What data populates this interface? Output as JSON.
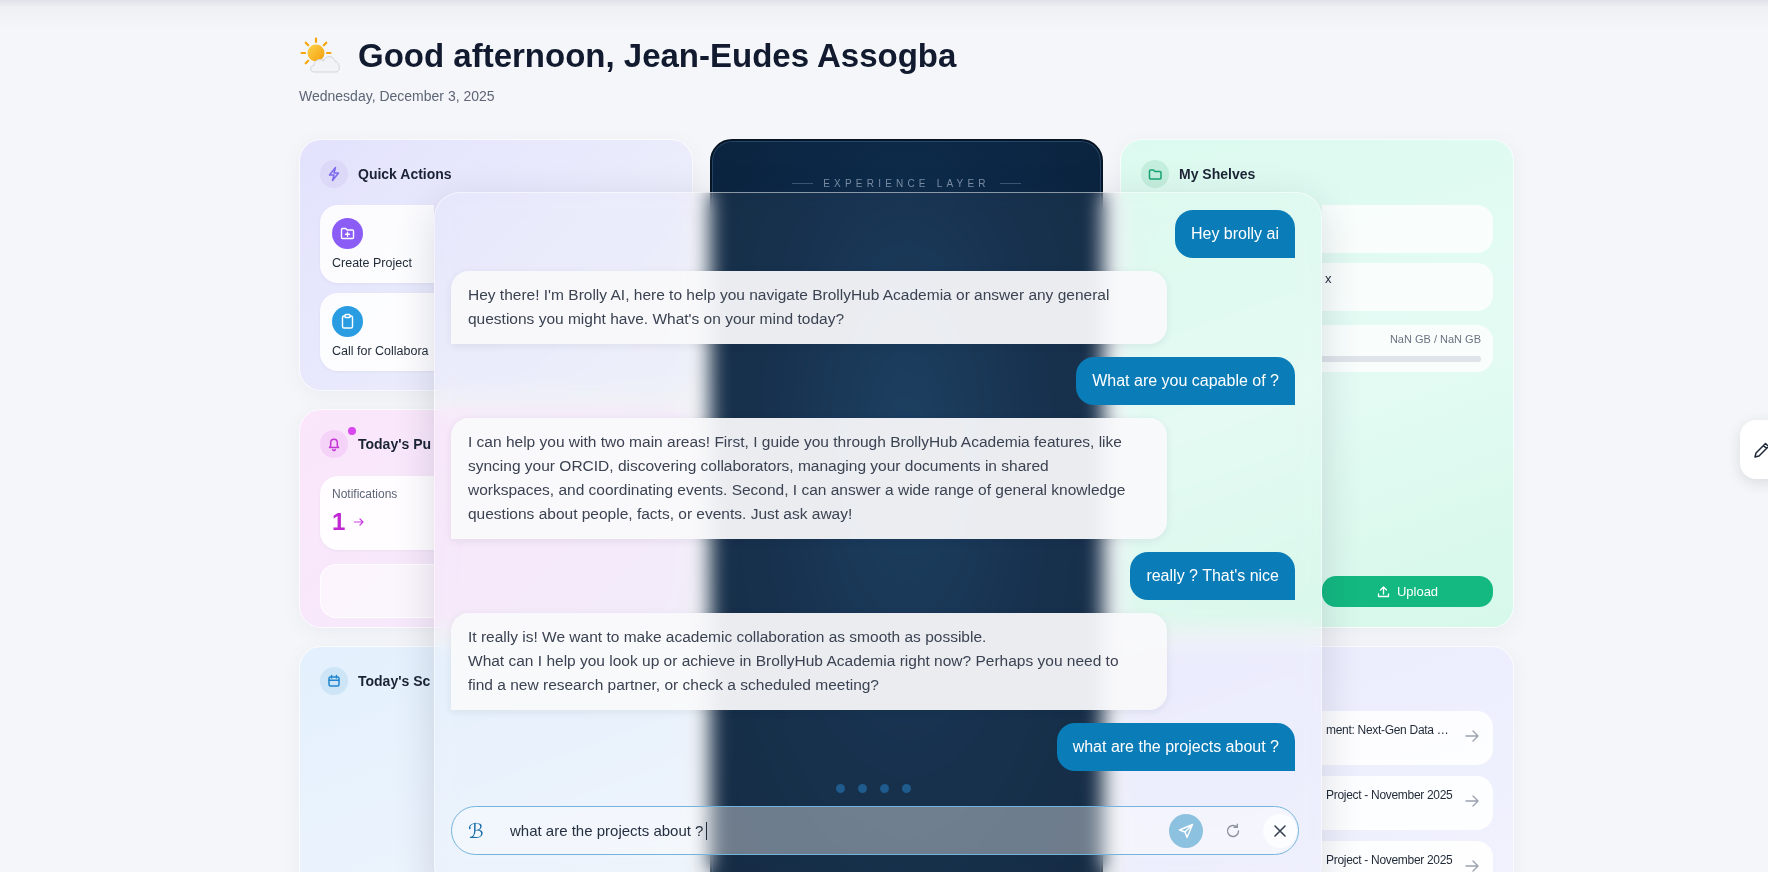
{
  "header": {
    "greeting": "Good afternoon, Jean-Eudes Assogba",
    "date": "Wednesday, December 3, 2025"
  },
  "quick_actions": {
    "title": "Quick Actions",
    "actions": [
      {
        "kind": "project",
        "label": "Create Project"
      },
      {
        "kind": "collaboration",
        "label": "Call for Collabora"
      }
    ]
  },
  "publications": {
    "title": "Today's Pu",
    "unread": true,
    "notifications": {
      "label": "Notifications",
      "count": "1"
    }
  },
  "schedule": {
    "title": "Today's Sc"
  },
  "experience": {
    "label": "EXPERIENCE LAYER"
  },
  "shelves": {
    "title": "My Shelves",
    "rows": [
      {
        "kind": "file"
      },
      {
        "kind": "file",
        "name": "x"
      },
      {
        "kind": "storage",
        "reading": "NaN GB / NaN GB"
      }
    ],
    "upload": "Upload"
  },
  "projects": {
    "items": [
      {
        "title": "ment: Next-Gen Data …"
      },
      {
        "title": "Project - November 2025"
      },
      {
        "title": "Project - November 2025"
      }
    ]
  },
  "chat": {
    "messages": [
      {
        "kind": "user",
        "text": "Hey brolly ai"
      },
      {
        "kind": "assistant",
        "text": "Hey there! I'm Brolly AI, here to help you navigate BrollyHub Academia or answer any general questions you might have. What's on your mind today?"
      },
      {
        "kind": "user",
        "text": "What are you capable of ?"
      },
      {
        "kind": "assistant",
        "text": "I can help you with two main areas! First, I guide you through BrollyHub Academia features, like syncing your ORCID, discovering collaborators, managing your documents in shared workspaces, and coordinating events. Second, I can answer a wide range of general knowledge questions about people, facts, or events. Just ask away!"
      },
      {
        "kind": "user",
        "text": "really ? That's nice"
      },
      {
        "kind": "assistant",
        "text": "It really is! We want to make academic collaboration as smooth as possible.\nWhat can I help you look up or achieve in BrollyHub Academia right now? Perhaps you need to find a new research partner, or check a scheduled meeting?"
      },
      {
        "kind": "user",
        "text": "what are the projects about ?"
      }
    ],
    "typing": true,
    "input": {
      "logo": "ℬ",
      "value": "what are the projects about ?"
    },
    "send": {
      "disabled": true
    }
  }
}
